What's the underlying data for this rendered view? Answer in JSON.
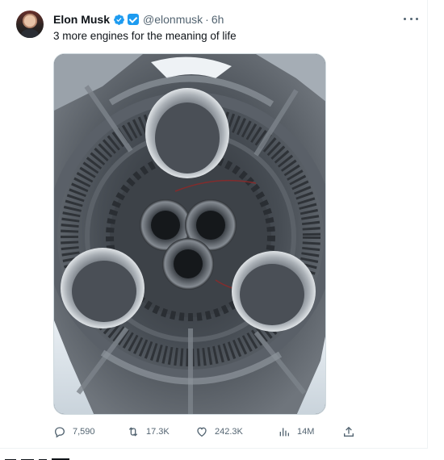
{
  "author": {
    "name": "Elon Musk",
    "handle": "@elonmusk",
    "separator": "·",
    "time": "6h"
  },
  "tweet": {
    "text": "3 more engines for the meaning of life"
  },
  "media": {
    "icon": "rocket-engines-photo"
  },
  "actions": {
    "replies": "7,590",
    "retweets": "17.3K",
    "likes": "242.3K",
    "views": "14M"
  },
  "colors": {
    "verified": "#1d9bf0",
    "text_secondary": "#536471",
    "text_primary": "#0f1419"
  }
}
